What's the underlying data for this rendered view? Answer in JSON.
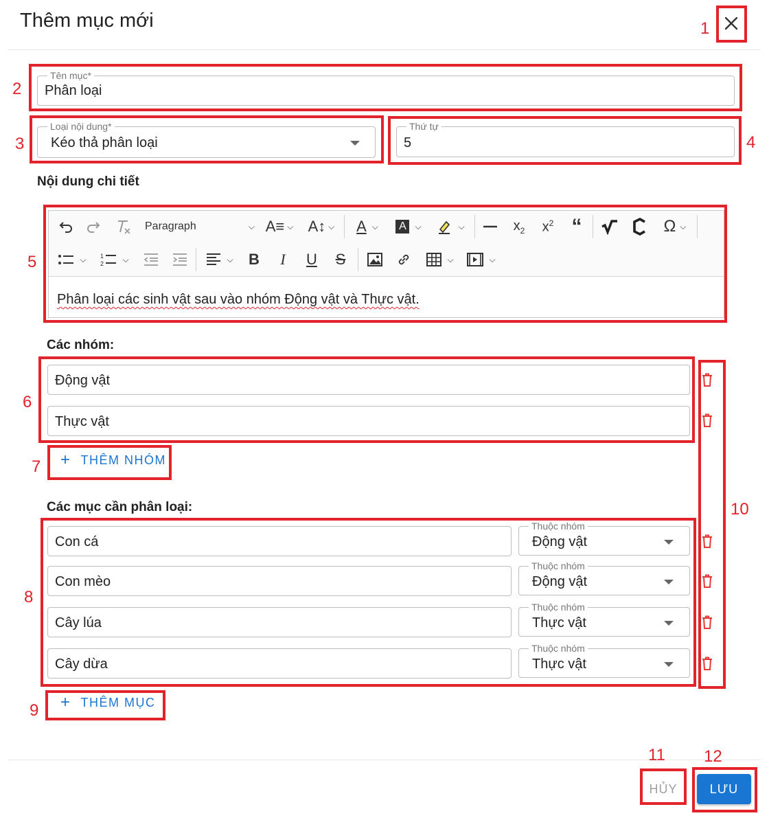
{
  "dialog": {
    "title": "Thêm mục mới",
    "cancel_label": "HỦY",
    "save_label": "LƯU"
  },
  "form": {
    "name": {
      "label": "Tên mục*",
      "value": "Phân loại"
    },
    "content_type": {
      "label": "Loại nội dung*",
      "value": "Kéo thả phân loại"
    },
    "order": {
      "label": "Thứ tự",
      "value": "5"
    },
    "detail_heading": "Nội dung chi tiết"
  },
  "editor": {
    "paragraph_style": "Paragraph",
    "content": "Phân loại các sinh vật sau vào nhóm Động vật và Thực vật."
  },
  "groups": {
    "heading": "Các nhóm:",
    "items": [
      "Động vật",
      "Thực vật"
    ],
    "add_label": "THÊM NHÓM"
  },
  "items": {
    "heading": "Các mục cần phân loại:",
    "group_select_label": "Thuộc nhóm",
    "rows": [
      {
        "name": "Con cá",
        "group": "Động vật"
      },
      {
        "name": "Con mèo",
        "group": "Động vật"
      },
      {
        "name": "Cây lúa",
        "group": "Thực vật"
      },
      {
        "name": "Cây dừa",
        "group": "Thực vật"
      }
    ],
    "add_label": "THÊM MỤC"
  },
  "annotations": [
    "1",
    "2",
    "3",
    "4",
    "5",
    "6",
    "7",
    "8",
    "9",
    "10",
    "11",
    "12"
  ],
  "colors": {
    "accent": "#1976d2",
    "annotation": "#e3232b",
    "delete": "#e53935"
  },
  "icons": {
    "close": "close-icon",
    "undo": "undo-icon",
    "redo": "redo-icon",
    "clear_format": "clear-format-icon",
    "dropdown": "chevron-down-icon",
    "delete": "trash-icon",
    "add": "plus-icon"
  }
}
